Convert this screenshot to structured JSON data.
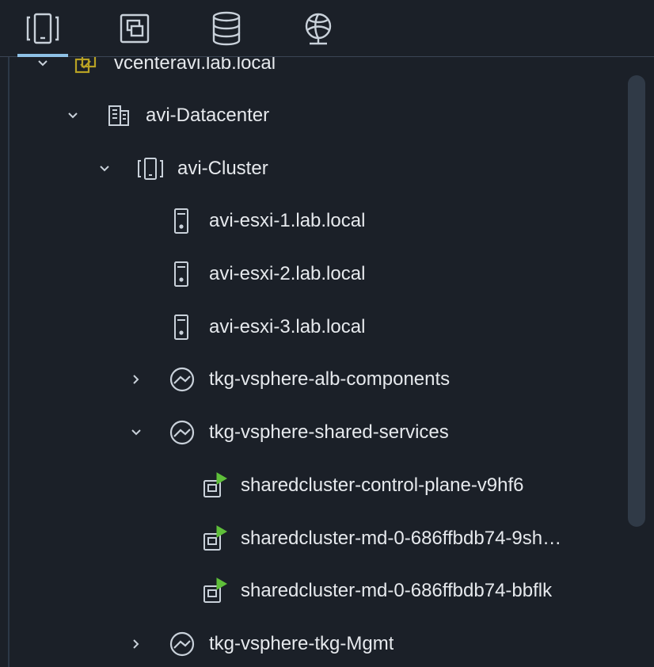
{
  "tabs": [
    {
      "name": "hosts-and-clusters",
      "icon": "hosts-clusters-icon",
      "active": true
    },
    {
      "name": "vms-and-templates",
      "icon": "vms-templates-icon",
      "active": false
    },
    {
      "name": "storage",
      "icon": "storage-icon",
      "active": false
    },
    {
      "name": "networking",
      "icon": "network-icon",
      "active": false
    }
  ],
  "tree": {
    "vcenter": {
      "label": "vcenteravi.lab.local",
      "expanded": true,
      "icon": "vcenter-icon"
    },
    "datacenter": {
      "label": "avi-Datacenter",
      "expanded": true,
      "icon": "datacenter-icon"
    },
    "cluster": {
      "label": "avi-Cluster",
      "expanded": true,
      "icon": "cluster-icon"
    },
    "hosts": [
      {
        "label": "avi-esxi-1.lab.local",
        "icon": "host-icon"
      },
      {
        "label": "avi-esxi-2.lab.local",
        "icon": "host-icon"
      },
      {
        "label": "avi-esxi-3.lab.local",
        "icon": "host-icon"
      }
    ],
    "resource_pools": [
      {
        "label": "tkg-vsphere-alb-components",
        "expanded": false,
        "icon": "resource-pool-icon"
      },
      {
        "label": "tkg-vsphere-shared-services",
        "expanded": true,
        "icon": "resource-pool-icon"
      }
    ],
    "vms": [
      {
        "label": "sharedcluster-control-plane-v9hf6",
        "icon": "vm-powered-on-icon"
      },
      {
        "label": "sharedcluster-md-0-686ffbdb74-9sh…",
        "icon": "vm-powered-on-icon"
      },
      {
        "label": "sharedcluster-md-0-686ffbdb74-bbflk",
        "icon": "vm-powered-on-icon"
      }
    ],
    "last_pool": {
      "label": "tkg-vsphere-tkg-Mgmt",
      "expanded": false,
      "icon": "resource-pool-icon"
    }
  },
  "colors": {
    "background": "#1b2028",
    "text": "#e6e9ed",
    "icon": "#c9d1da",
    "active_tab": "#8ec1e6",
    "vcenter_icon": "#b8a224",
    "power_on": "#5fbf3a"
  }
}
